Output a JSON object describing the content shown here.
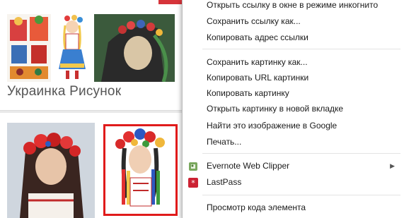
{
  "results": {
    "topic_title": "Украинка Рисунок"
  },
  "context_menu": {
    "items": [
      {
        "label": "Открыть ссылку в окне в режиме инкогнито"
      },
      {
        "label": "Сохранить ссылку как..."
      },
      {
        "label": "Копировать адрес ссылки"
      },
      {
        "label": "Сохранить картинку как..."
      },
      {
        "label": "Копировать URL картинки"
      },
      {
        "label": "Копировать картинку"
      },
      {
        "label": "Открыть картинку в новой вкладке"
      },
      {
        "label": "Найти это изображение в Google"
      },
      {
        "label": "Печать..."
      },
      {
        "label": "Evernote Web Clipper",
        "icon": "evernote-icon"
      },
      {
        "label": "LastPass",
        "icon": "lastpass-icon"
      },
      {
        "label": "Просмотр кода элемента"
      }
    ]
  },
  "annotations": {
    "highlight_color": "#e01b1b"
  }
}
